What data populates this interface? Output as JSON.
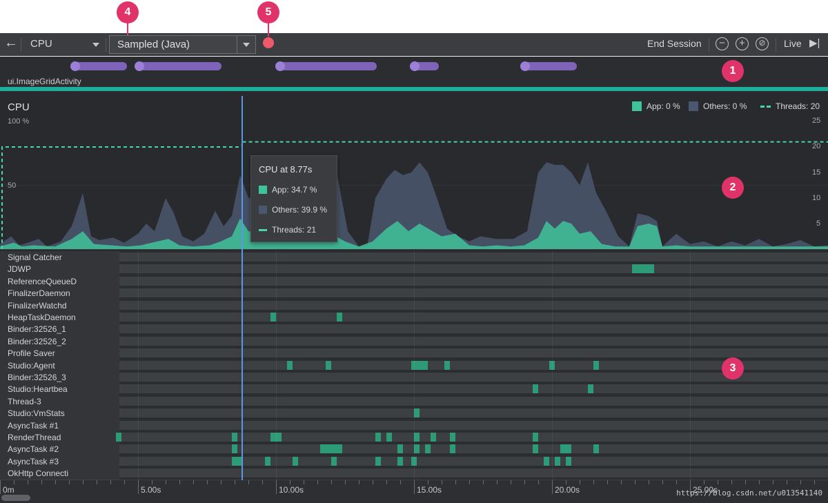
{
  "callouts": {
    "one": "1",
    "two": "2",
    "three": "3",
    "four": "4",
    "five": "5"
  },
  "toolbar": {
    "back_icon": "←",
    "cpu_label": "CPU",
    "mode_label": "Sampled (Java)",
    "end_session": "End Session",
    "zoom_out": "−",
    "zoom_in": "+",
    "reset_zoom": "⊘",
    "live_label": "Live",
    "live_icon": "▶|"
  },
  "events": {
    "activity": "ui.ImageGridActivity"
  },
  "cpu": {
    "title": "CPU",
    "left_axis_top": "100 %",
    "left_axis_mid": "50",
    "right_axis": [
      "25",
      "20",
      "15",
      "10",
      "5"
    ],
    "legend": {
      "app": "App: 0 %",
      "others": "Others: 0 %",
      "threads": "Threads: 20"
    },
    "colors": {
      "app": "#3fc39a",
      "others": "#4a5770",
      "threads": "#49d6a8"
    }
  },
  "tooltip": {
    "title": "CPU at 8.77s",
    "app": "App: 34.7 %",
    "others": "Others: 39.9 %",
    "threads": "Threads: 21"
  },
  "threads": [
    {
      "name": "Signal Catcher",
      "segments": []
    },
    {
      "name": "JDWP",
      "segments": [
        [
          22.9,
          23.7
        ]
      ]
    },
    {
      "name": "ReferenceQueueD",
      "segments": []
    },
    {
      "name": "FinalizerDaemon",
      "segments": []
    },
    {
      "name": "FinalizerWatchd",
      "segments": []
    },
    {
      "name": "HeapTaskDaemon",
      "segments": [
        [
          9.8,
          10.0
        ],
        [
          12.2,
          12.4
        ]
      ]
    },
    {
      "name": "Binder:32526_1",
      "segments": []
    },
    {
      "name": "Binder:32526_2",
      "segments": []
    },
    {
      "name": "Profile Saver",
      "segments": []
    },
    {
      "name": "Studio:Agent",
      "segments": [
        [
          10.4,
          10.6
        ],
        [
          11.8,
          12.0
        ],
        [
          14.9,
          15.5
        ],
        [
          16.1,
          16.3
        ],
        [
          19.9,
          20.1
        ],
        [
          21.5,
          21.7
        ]
      ]
    },
    {
      "name": "Binder:32526_3",
      "segments": []
    },
    {
      "name": "Studio:Heartbea",
      "segments": [
        [
          19.3,
          19.5
        ],
        [
          21.3,
          21.5
        ]
      ]
    },
    {
      "name": "Thread-3",
      "segments": []
    },
    {
      "name": "Studio:VmStats",
      "segments": [
        [
          15.0,
          15.2
        ]
      ]
    },
    {
      "name": "AsyncTask #1",
      "segments": []
    },
    {
      "name": "RenderThread",
      "segments": [
        [
          4.2,
          4.4
        ],
        [
          8.4,
          8.6
        ],
        [
          9.8,
          10.2
        ],
        [
          13.6,
          13.8
        ],
        [
          14.0,
          14.2
        ],
        [
          15.0,
          15.2
        ],
        [
          15.6,
          15.8
        ],
        [
          16.3,
          16.5
        ],
        [
          19.3,
          19.5
        ]
      ]
    },
    {
      "name": "AsyncTask #2",
      "segments": [
        [
          8.4,
          8.6
        ],
        [
          11.6,
          12.4
        ],
        [
          14.4,
          14.6
        ],
        [
          15.0,
          15.2
        ],
        [
          15.4,
          15.6
        ],
        [
          16.3,
          16.5
        ],
        [
          19.3,
          19.5
        ],
        [
          20.3,
          20.7
        ],
        [
          21.5,
          21.7
        ]
      ]
    },
    {
      "name": "AsyncTask #3",
      "segments": [
        [
          8.4,
          8.8
        ],
        [
          9.6,
          9.8
        ],
        [
          10.6,
          10.8
        ],
        [
          12.0,
          12.2
        ],
        [
          13.6,
          13.8
        ],
        [
          14.4,
          14.6
        ],
        [
          14.9,
          15.1
        ],
        [
          19.7,
          19.9
        ],
        [
          20.1,
          20.3
        ],
        [
          20.5,
          20.7
        ]
      ]
    },
    {
      "name": "OkHttp Connecti",
      "segments": []
    }
  ],
  "timeline": {
    "start_label": "0m",
    "ticks": [
      "5.00s",
      "10.00s",
      "15.00s",
      "20.00s",
      "25.00s"
    ],
    "watermark": "https://blog.csdn.net/u013541140"
  },
  "chart_data": {
    "type": "area",
    "title": "CPU",
    "x_unit": "s",
    "xlim": [
      0,
      30
    ],
    "ylim": [
      0,
      100
    ],
    "right_ylim": [
      0,
      25
    ],
    "cursor_time": 8.77,
    "series": [
      {
        "name": "Others",
        "values": [
          [
            0,
            4
          ],
          [
            0.4,
            10
          ],
          [
            0.7,
            3
          ],
          [
            1.0,
            5
          ],
          [
            1.4,
            8
          ],
          [
            1.7,
            2
          ],
          [
            2.2,
            6
          ],
          [
            2.6,
            18
          ],
          [
            3.0,
            44
          ],
          [
            3.3,
            10
          ],
          [
            3.6,
            7
          ],
          [
            4.1,
            9
          ],
          [
            4.5,
            5
          ],
          [
            5.0,
            12
          ],
          [
            5.3,
            20
          ],
          [
            5.6,
            14
          ],
          [
            6.0,
            40
          ],
          [
            6.3,
            28
          ],
          [
            6.6,
            10
          ],
          [
            7.0,
            6
          ],
          [
            7.4,
            12
          ],
          [
            7.8,
            30
          ],
          [
            8.1,
            18
          ],
          [
            8.4,
            26
          ],
          [
            8.7,
            58
          ],
          [
            9.0,
            40
          ],
          [
            9.5,
            42
          ],
          [
            10.0,
            38
          ],
          [
            10.5,
            52
          ],
          [
            11.0,
            56
          ],
          [
            11.4,
            62
          ],
          [
            11.8,
            70
          ],
          [
            12.2,
            60
          ],
          [
            12.6,
            14
          ],
          [
            13.0,
            2
          ],
          [
            13.3,
            2
          ],
          [
            13.6,
            40
          ],
          [
            14.0,
            55
          ],
          [
            14.3,
            62
          ],
          [
            14.6,
            58
          ],
          [
            14.9,
            60
          ],
          [
            15.2,
            68
          ],
          [
            15.5,
            60
          ],
          [
            15.8,
            42
          ],
          [
            16.2,
            16
          ],
          [
            16.6,
            10
          ],
          [
            17.0,
            6
          ],
          [
            17.4,
            10
          ],
          [
            18.0,
            8
          ],
          [
            18.6,
            8
          ],
          [
            19.1,
            14
          ],
          [
            19.5,
            60
          ],
          [
            19.8,
            68
          ],
          [
            20.1,
            66
          ],
          [
            20.4,
            66
          ],
          [
            20.7,
            60
          ],
          [
            21.0,
            50
          ],
          [
            21.3,
            68
          ],
          [
            21.6,
            44
          ],
          [
            22.0,
            28
          ],
          [
            22.4,
            10
          ],
          [
            22.8,
            2
          ],
          [
            23.1,
            28
          ],
          [
            23.5,
            26
          ],
          [
            23.8,
            22
          ],
          [
            24.0,
            2
          ],
          [
            24.5,
            12
          ],
          [
            25.0,
            4
          ],
          [
            25.5,
            6
          ],
          [
            26.0,
            2
          ],
          [
            26.5,
            6
          ],
          [
            27.0,
            3
          ],
          [
            27.5,
            8
          ],
          [
            28.0,
            2
          ],
          [
            28.5,
            4
          ],
          [
            29.0,
            7
          ],
          [
            29.5,
            2
          ],
          [
            30,
            3
          ]
        ]
      },
      {
        "name": "App",
        "values": [
          [
            0,
            2
          ],
          [
            0.5,
            5
          ],
          [
            0.8,
            2
          ],
          [
            1.2,
            3
          ],
          [
            2.0,
            2
          ],
          [
            2.6,
            8
          ],
          [
            3.0,
            14
          ],
          [
            3.4,
            4
          ],
          [
            4.0,
            3
          ],
          [
            4.6,
            2
          ],
          [
            5.1,
            3
          ],
          [
            5.5,
            5
          ],
          [
            6.1,
            8
          ],
          [
            6.5,
            3
          ],
          [
            7.0,
            2
          ],
          [
            7.6,
            3
          ],
          [
            8.0,
            6
          ],
          [
            8.4,
            10
          ],
          [
            8.7,
            24
          ],
          [
            9.0,
            14
          ],
          [
            9.5,
            12
          ],
          [
            10.0,
            6
          ],
          [
            10.5,
            14
          ],
          [
            11.0,
            8
          ],
          [
            11.5,
            10
          ],
          [
            12.0,
            12
          ],
          [
            12.5,
            6
          ],
          [
            13.0,
            2
          ],
          [
            13.5,
            6
          ],
          [
            14.0,
            16
          ],
          [
            14.4,
            22
          ],
          [
            14.8,
            14
          ],
          [
            15.2,
            20
          ],
          [
            15.6,
            15
          ],
          [
            16.0,
            10
          ],
          [
            16.5,
            12
          ],
          [
            17.0,
            3
          ],
          [
            17.5,
            2
          ],
          [
            18.0,
            3
          ],
          [
            18.5,
            2
          ],
          [
            19.0,
            3
          ],
          [
            19.5,
            9
          ],
          [
            19.8,
            22
          ],
          [
            20.1,
            16
          ],
          [
            20.4,
            22
          ],
          [
            20.7,
            20
          ],
          [
            21.0,
            12
          ],
          [
            21.4,
            14
          ],
          [
            21.8,
            4
          ],
          [
            22.3,
            2
          ],
          [
            22.8,
            2
          ],
          [
            23.1,
            18
          ],
          [
            23.5,
            20
          ],
          [
            23.8,
            18
          ],
          [
            24.0,
            2
          ],
          [
            24.5,
            3
          ],
          [
            25.0,
            2
          ],
          [
            26.0,
            2
          ],
          [
            27.0,
            2
          ],
          [
            28.0,
            2
          ],
          [
            29.0,
            2
          ],
          [
            30,
            2
          ]
        ]
      },
      {
        "name": "Threads",
        "axis": "right",
        "values": [
          [
            0,
            20
          ],
          [
            8.77,
            20
          ],
          [
            8.77,
            21
          ],
          [
            30,
            21
          ]
        ]
      }
    ]
  }
}
